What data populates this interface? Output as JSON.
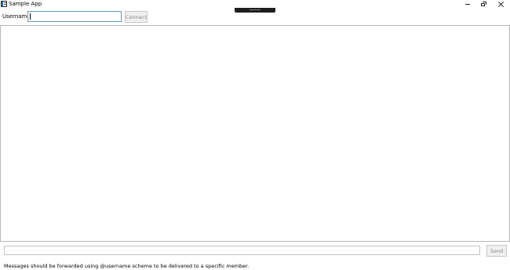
{
  "window": {
    "title": "Sample App",
    "controls": {
      "minimize_icon": "minimize-icon",
      "maximize_icon": "restore-icon",
      "close_icon": "close-icon"
    }
  },
  "connection": {
    "username_label": "Username:",
    "username_value": "",
    "username_placeholder": "",
    "connect_label": "Connect"
  },
  "messages": {
    "items": []
  },
  "compose": {
    "message_value": "",
    "message_placeholder": "",
    "send_label": "Send"
  },
  "footer": {
    "hint": "Messages should be forwarded using @username scheme to be delivered to a specific member."
  },
  "colors": {
    "focus_border": "#5b9bd5",
    "disabled_text": "#8a8a8a",
    "button_bg": "#f0f0f0"
  }
}
